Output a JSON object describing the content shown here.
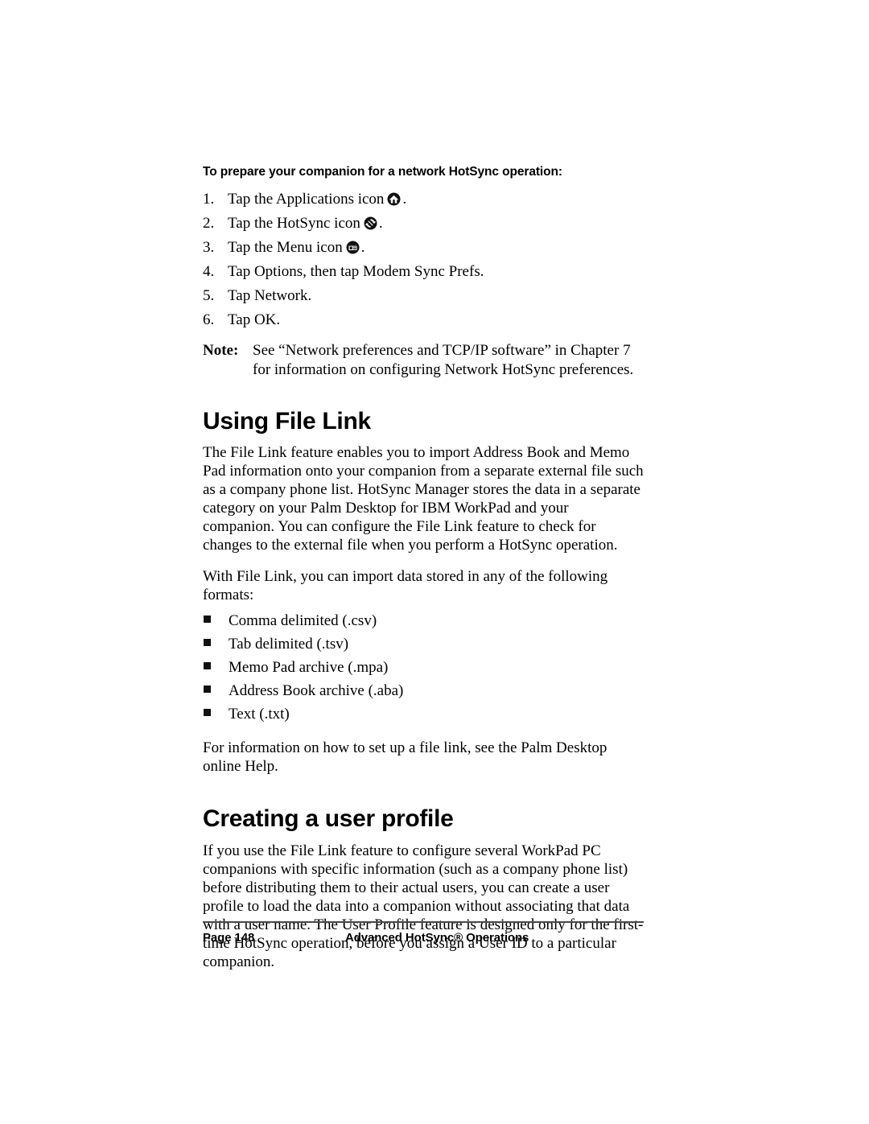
{
  "document": {
    "procedure": {
      "heading": "To prepare your companion for a network HotSync operation:",
      "steps": [
        {
          "number": "1.",
          "text_before": "Tap the Applications icon",
          "icon": "applications-home-icon",
          "text_after": "."
        },
        {
          "number": "2.",
          "text_before": "Tap the HotSync icon",
          "icon": "hotsync-circular-arrows-icon",
          "text_after": "."
        },
        {
          "number": "3.",
          "text_before": "Tap the Menu icon",
          "icon": "menu-icon",
          "text_after": "."
        },
        {
          "number": "4.",
          "text_before": "Tap Options, then tap Modem Sync Prefs.",
          "icon": null,
          "text_after": ""
        },
        {
          "number": "5.",
          "text_before": "Tap Network.",
          "icon": null,
          "text_after": ""
        },
        {
          "number": "6.",
          "text_before": "Tap OK.",
          "icon": null,
          "text_after": ""
        }
      ]
    },
    "note": {
      "label": "Note:",
      "text": "See “Network preferences and TCP/IP software” in Chapter 7 for information on configuring Network HotSync preferences."
    },
    "section_file_link": {
      "heading": "Using File Link",
      "paragraph_1": "The File Link feature enables you to import Address Book and Memo Pad information onto your companion from a separate external file such as a company phone list. HotSync Manager stores the data in a separate category on your Palm Desktop for IBM WorkPad and your companion. You can configure the File Link feature to check for changes to the external file when you perform a HotSync operation.",
      "paragraph_2": "With File Link, you can import data stored in any of the following formats:",
      "formats": [
        "Comma delimited (.csv)",
        "Tab delimited (.tsv)",
        "Memo Pad archive (.mpa)",
        "Address Book archive (.aba)",
        "Text (.txt)"
      ],
      "paragraph_3": "For information on how to set up a file link, see the Palm Desktop online Help."
    },
    "section_user_profile": {
      "heading": "Creating a user profile",
      "paragraph_1": "If you use the File Link feature to configure several WorkPad PC companions with specific information (such as a company phone list) before distributing them to their actual users, you can create a user profile to load the data into a companion without associating that data with a user name. The User Profile feature is designed only for the first-time HotSync operation, before you assign a User ID to a particular companion."
    },
    "footer": {
      "page_label": "Page 148",
      "chapter_title": "Advanced HotSync® Operations"
    },
    "colors": {
      "text": "#000000",
      "background": "#ffffff",
      "footer_rule": "#4a4a4a"
    }
  }
}
